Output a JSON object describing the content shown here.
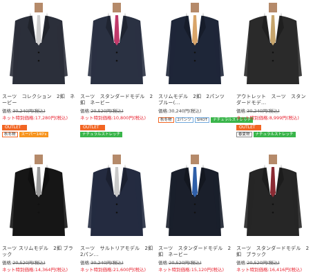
{
  "products": [
    {
      "name": "スーツ　コレクション　2釦　ネービー",
      "price_label": "価格:",
      "price_old": "30,240円(税込)",
      "sale_label": "ネット特別価格:",
      "sale_price": "17,280円(税込)",
      "outlet": "OUTLET",
      "tags": [
        "秋冬物",
        "スーパー140's"
      ],
      "suit": "#2b2f3a",
      "tie": "#cfcfcf",
      "shirt": "#ffffff"
    },
    {
      "name": "スーツ　スタンダードモデル　2釦　ネービー",
      "price_label": "価格:",
      "price_old": "20,520円(税込)",
      "sale_label": "ネット特別価格:",
      "sale_price": "10,800円(税込)",
      "outlet": "OUTLET",
      "tags": [
        "ナチュラルストレッチ"
      ],
      "suit": "#2a3142",
      "tie": "#c0396a",
      "shirt": "#ffffff"
    },
    {
      "name": "スリムモデル　2釦　2パンツ　ブルー(...",
      "price_label": "価格:",
      "price_old": "30,240円(税込)",
      "sale_label": "",
      "sale_price": "",
      "outlet": "",
      "tags": [
        "秋冬物",
        "2パンツ",
        "SHOT",
        "ナチュラルストレッチ"
      ],
      "suit": "#1e2638",
      "tie": "#d9a56a",
      "shirt": "#ffffff"
    },
    {
      "name": "アウトレット　スーツ　スタンダードモデ...",
      "price_label": "価格:",
      "price_old": "30,240円(税込)",
      "sale_label": "ネット特別価格:",
      "sale_price": "8,999円(税込)",
      "outlet": "OUTLET",
      "tags": [
        "春夏物",
        "ナチュラルストレッチ"
      ],
      "suit": "#2a2a2a",
      "tie": "#c7a56c",
      "shirt": "#ffffff"
    },
    {
      "name": "スーツ スリムモデル　2釦 ブラック",
      "price_label": "価格:",
      "price_old": "20,520円(税込)",
      "sale_label": "ネット特別価格:",
      "sale_price": "14,364円(税込)",
      "outlet": "",
      "tags": [],
      "suit": "#161616",
      "tie": "#9a9a9a",
      "shirt": "#ffffff"
    },
    {
      "name": "スーツ　サルトリアモデル　2釦　2パン...",
      "price_label": "価格:",
      "price_old": "30,240円(税込)",
      "sale_label": "ネット特別価格:",
      "sale_price": "21,600円(税込)",
      "outlet": "",
      "tags": [],
      "suit": "#242b40",
      "tie": "#c9c9c9",
      "shirt": "#ffffff"
    },
    {
      "name": "スーツ　スタンダードモデル　2釦　ネービー",
      "price_label": "価格:",
      "price_old": "20,520円(税込)",
      "sale_label": "ネット特別価格:",
      "sale_price": "15,120円(税込)",
      "outlet": "",
      "tags": [],
      "suit": "#1a1f2b",
      "tie": "#2f5fa8",
      "shirt": "#ffffff"
    },
    {
      "name": "スーツ　スタンダードモデル　2釦　ブラック",
      "price_label": "価格:",
      "price_old": "20,520円(税込)",
      "sale_label": "ネット特別価格:",
      "sale_price": "16,416円(税込)",
      "outlet": "",
      "tags": [],
      "suit": "#262626",
      "tie": "#8a2a33",
      "shirt": "#ffffff"
    }
  ]
}
